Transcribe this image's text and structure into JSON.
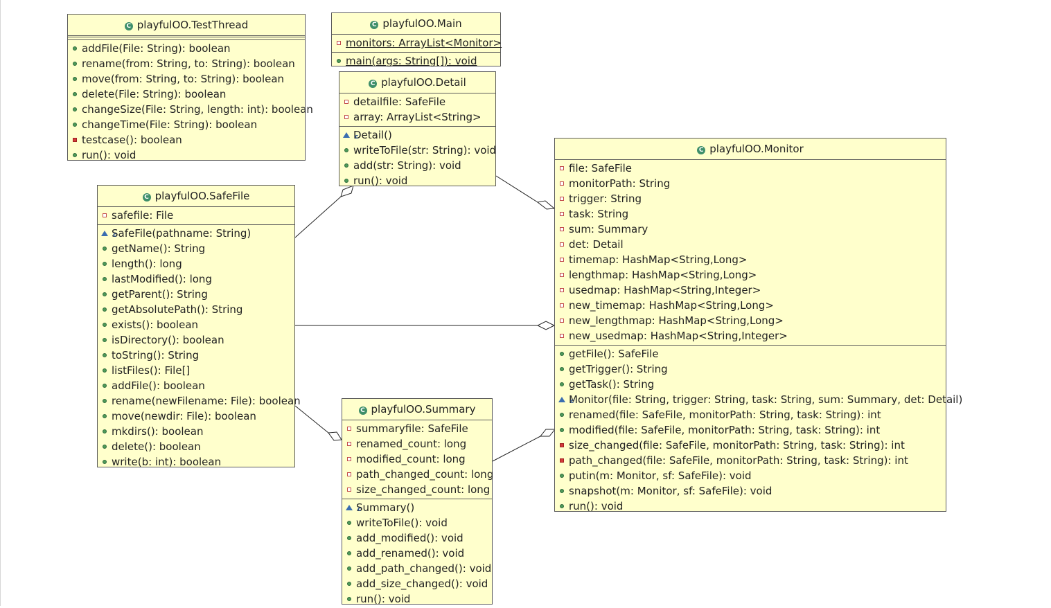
{
  "diagram": {
    "classes": [
      {
        "id": "testthread",
        "name": "playfulOO.TestThread",
        "attributes": [],
        "operations": [
          {
            "vis": "pub",
            "text": "addFile(File: String): boolean"
          },
          {
            "vis": "pub",
            "text": "rename(from: String, to: String): boolean"
          },
          {
            "vis": "pub",
            "text": "move(from: String, to: String): boolean"
          },
          {
            "vis": "pub",
            "text": "delete(File: String): boolean"
          },
          {
            "vis": "pub",
            "text": "changeSize(File: String, length: int): boolean"
          },
          {
            "vis": "pub",
            "text": "changeTime(File: String): boolean"
          },
          {
            "vis": "privm",
            "text": "testcase(): boolean"
          },
          {
            "vis": "pub",
            "text": "run(): void"
          }
        ]
      },
      {
        "id": "main",
        "name": "playfulOO.Main",
        "attributes": [
          {
            "vis": "priv",
            "text": "monitors: ArrayList<Monitor>",
            "static": true
          }
        ],
        "operations": [
          {
            "vis": "pub",
            "text": "main(args: String[]): void",
            "static": true
          }
        ]
      },
      {
        "id": "detail",
        "name": "playfulOO.Detail",
        "attributes": [
          {
            "vis": "priv",
            "text": "detailfile: SafeFile"
          },
          {
            "vis": "priv",
            "text": "array: ArrayList<String>"
          }
        ],
        "operations": [
          {
            "vis": "ctor",
            "text": "Detail()"
          },
          {
            "vis": "pub",
            "text": "writeToFile(str: String): void"
          },
          {
            "vis": "pub",
            "text": "add(str: String): void"
          },
          {
            "vis": "pub",
            "text": "run(): void"
          }
        ]
      },
      {
        "id": "safefile",
        "name": "playfulOO.SafeFile",
        "attributes": [
          {
            "vis": "priv",
            "text": "safefile: File"
          }
        ],
        "operations": [
          {
            "vis": "ctor",
            "text": "SafeFile(pathname: String)"
          },
          {
            "vis": "pub",
            "text": "getName(): String"
          },
          {
            "vis": "pub",
            "text": "length(): long"
          },
          {
            "vis": "pub",
            "text": "lastModified(): long"
          },
          {
            "vis": "pub",
            "text": "getParent(): String"
          },
          {
            "vis": "pub",
            "text": "getAbsolutePath(): String"
          },
          {
            "vis": "pub",
            "text": "exists(): boolean"
          },
          {
            "vis": "pub",
            "text": "isDirectory(): boolean"
          },
          {
            "vis": "pub",
            "text": "toString(): String"
          },
          {
            "vis": "pub",
            "text": "listFiles(): File[]"
          },
          {
            "vis": "pub",
            "text": "addFile(): boolean"
          },
          {
            "vis": "pub",
            "text": "rename(newFilename: File): boolean"
          },
          {
            "vis": "pub",
            "text": "move(newdir: File): boolean"
          },
          {
            "vis": "pub",
            "text": "mkdirs(): boolean"
          },
          {
            "vis": "pub",
            "text": "delete(): boolean"
          },
          {
            "vis": "pub",
            "text": "write(b: int): boolean"
          }
        ]
      },
      {
        "id": "summary",
        "name": "playfulOO.Summary",
        "attributes": [
          {
            "vis": "priv",
            "text": "summaryfile: SafeFile"
          },
          {
            "vis": "priv",
            "text": "renamed_count: long"
          },
          {
            "vis": "priv",
            "text": "modified_count: long"
          },
          {
            "vis": "priv",
            "text": "path_changed_count: long"
          },
          {
            "vis": "priv",
            "text": "size_changed_count: long"
          }
        ],
        "operations": [
          {
            "vis": "ctor",
            "text": "Summary()"
          },
          {
            "vis": "pub",
            "text": "writeToFile(): void"
          },
          {
            "vis": "pub",
            "text": "add_modified(): void"
          },
          {
            "vis": "pub",
            "text": "add_renamed(): void"
          },
          {
            "vis": "pub",
            "text": "add_path_changed(): void"
          },
          {
            "vis": "pub",
            "text": "add_size_changed(): void"
          },
          {
            "vis": "pub",
            "text": "run(): void"
          }
        ]
      },
      {
        "id": "monitor",
        "name": "playfulOO.Monitor",
        "attributes": [
          {
            "vis": "priv",
            "text": "file: SafeFile"
          },
          {
            "vis": "priv",
            "text": "monitorPath: String"
          },
          {
            "vis": "priv",
            "text": "trigger: String"
          },
          {
            "vis": "priv",
            "text": "task: String"
          },
          {
            "vis": "priv",
            "text": "sum: Summary"
          },
          {
            "vis": "priv",
            "text": "det: Detail"
          },
          {
            "vis": "priv",
            "text": "timemap: HashMap<String,Long>"
          },
          {
            "vis": "priv",
            "text": "lengthmap: HashMap<String,Long>"
          },
          {
            "vis": "priv",
            "text": "usedmap: HashMap<String,Integer>"
          },
          {
            "vis": "priv",
            "text": "new_timemap: HashMap<String,Long>"
          },
          {
            "vis": "priv",
            "text": "new_lengthmap: HashMap<String,Long>"
          },
          {
            "vis": "priv",
            "text": "new_usedmap: HashMap<String,Integer>"
          }
        ],
        "operations": [
          {
            "vis": "pub",
            "text": "getFile(): SafeFile"
          },
          {
            "vis": "pub",
            "text": "getTrigger(): String"
          },
          {
            "vis": "pub",
            "text": "getTask(): String"
          },
          {
            "vis": "ctor",
            "text": "Monitor(file: String, trigger: String, task: String, sum: Summary, det: Detail)"
          },
          {
            "vis": "pub",
            "text": "renamed(file: SafeFile, monitorPath: String, task: String): int"
          },
          {
            "vis": "pub",
            "text": "modified(file: SafeFile, monitorPath: String, task: String): int"
          },
          {
            "vis": "privm",
            "text": "size_changed(file: SafeFile, monitorPath: String, task: String): int"
          },
          {
            "vis": "privm",
            "text": "path_changed(file: SafeFile, monitorPath: String, task: String): int"
          },
          {
            "vis": "pub",
            "text": "putin(m: Monitor, sf: SafeFile): void"
          },
          {
            "vis": "pub",
            "text": "snapshot(m: Monitor, sf: SafeFile): void"
          },
          {
            "vis": "pub",
            "text": "run(): void"
          }
        ]
      }
    ],
    "relations": [
      {
        "from": "safefile",
        "to": "detail",
        "type": "aggregation",
        "diamond_at": "detail"
      },
      {
        "from": "detail",
        "to": "monitor",
        "type": "aggregation",
        "diamond_at": "monitor"
      },
      {
        "from": "safefile",
        "to": "monitor",
        "type": "aggregation",
        "diamond_at": "monitor"
      },
      {
        "from": "safefile",
        "to": "summary",
        "type": "aggregation",
        "diamond_at": "summary"
      },
      {
        "from": "summary",
        "to": "monitor",
        "type": "aggregation",
        "diamond_at": "monitor"
      }
    ],
    "colors": {
      "class_fill": "#ffffcc",
      "border": "#5a5a5a",
      "public": "#4e9a5a",
      "private": "#c24a4a",
      "constructor": "#3a6db0"
    }
  }
}
